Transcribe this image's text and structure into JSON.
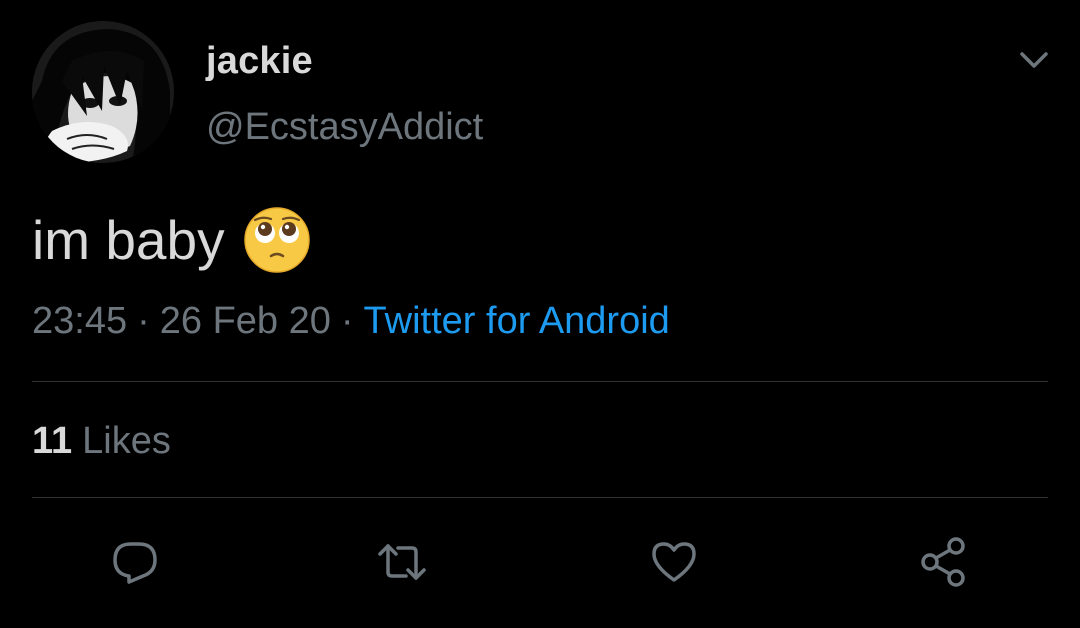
{
  "tweet": {
    "display_name": "jackie",
    "handle": "@EcstasyAddict",
    "text": "im baby",
    "emoji": "pleading-face-emoji",
    "time": "23:45",
    "date": "26 Feb 20",
    "separator": "·",
    "source": "Twitter for Android",
    "likes_count": "11",
    "likes_label": "Likes"
  },
  "actions": {
    "reply": "reply-icon",
    "retweet": "retweet-icon",
    "like": "heart-icon",
    "share": "share-icon"
  },
  "colors": {
    "background": "#000000",
    "primary_text": "#d9d9d9",
    "secondary_text": "#6e767d",
    "link": "#1d9bf0",
    "divider": "#2f3336"
  }
}
